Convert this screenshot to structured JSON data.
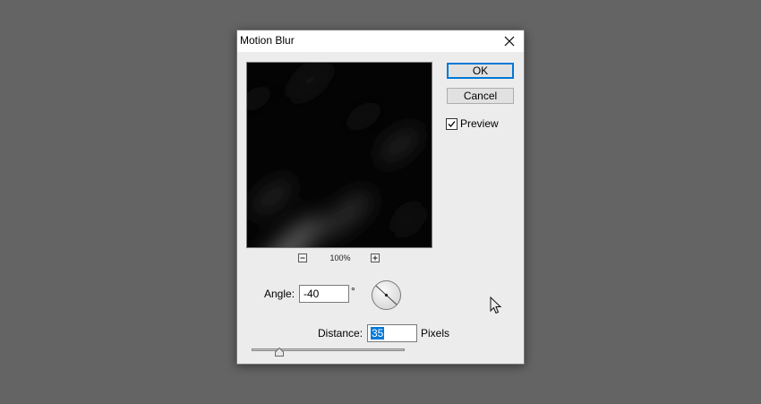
{
  "dialog": {
    "title": "Motion Blur",
    "ok_label": "OK",
    "cancel_label": "Cancel",
    "preview_checkbox": {
      "label": "Preview",
      "checked": true
    },
    "zoom": {
      "minus": "−",
      "level": "100%",
      "plus": "+"
    },
    "angle": {
      "label": "Angle:",
      "value": "-40",
      "unit": "°"
    },
    "distance": {
      "label": "Distance:",
      "value": "35",
      "unit": "Pixels"
    },
    "distance_slider": {
      "value": 35,
      "max": 2000
    }
  },
  "icons": [
    "close-icon",
    "minus-icon",
    "plus-icon",
    "checkmark-icon",
    "angle-dial-icon",
    "mouse-cursor-icon"
  ],
  "colors": {
    "desktop": "#646464",
    "dialog_bg": "#ececec",
    "accent": "#0078d7"
  }
}
